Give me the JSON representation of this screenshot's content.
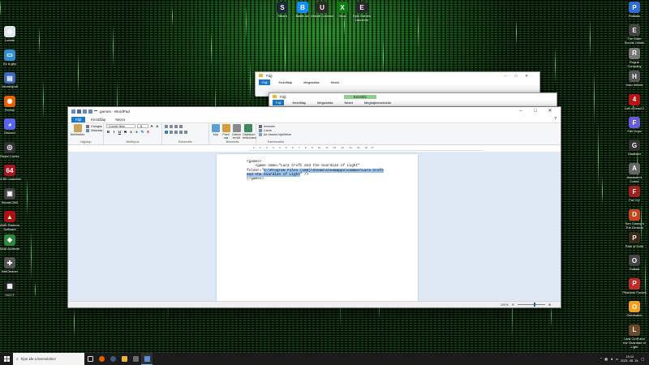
{
  "desktop": {
    "top_icons": [
      {
        "label": "Steam",
        "color": "#1b2838",
        "glyph": "S"
      },
      {
        "label": "Battle.net",
        "color": "#148eff",
        "glyph": "B"
      },
      {
        "label": "Ubisoft Connect",
        "color": "#2b2b2b",
        "glyph": "U"
      },
      {
        "label": "Xbox",
        "color": "#107c10",
        "glyph": "X"
      },
      {
        "label": "Epic Games Launcher",
        "color": "#2a2a2a",
        "glyph": "E"
      }
    ],
    "left_icons": [
      {
        "label": "Lomtár",
        "color": "#dfe6ee",
        "glyph": "♻"
      },
      {
        "label": "Ez a gép",
        "color": "#2f8ed8",
        "glyph": "▭"
      },
      {
        "label": "Vezérlőpult",
        "color": "#3a66c4",
        "glyph": "▤"
      },
      {
        "label": "Firefox",
        "color": "#e66000",
        "glyph": "◉"
      },
      {
        "label": "Discord",
        "color": "#5865f2",
        "glyph": "◕"
      },
      {
        "label": "Razer Cortex",
        "color": "#333",
        "glyph": "◎"
      },
      {
        "label": "64 Bit Launcher",
        "color": "#b01020",
        "glyph": "64"
      },
      {
        "label": "SteamCMD",
        "color": "#444",
        "glyph": "▣"
      },
      {
        "label": "AMD Radeon Software",
        "color": "#b01010",
        "glyph": "▲"
      },
      {
        "label": "SAM Achiever",
        "color": "#2a8a3a",
        "glyph": "◆"
      },
      {
        "label": "NetCleaner",
        "color": "#555",
        "glyph": "✚"
      },
      {
        "label": "OCCT",
        "color": "#222",
        "glyph": "▦"
      }
    ],
    "right_icons": [
      {
        "label": "Palladin",
        "color": "#2a6ed6",
        "glyph": "P"
      },
      {
        "label": "The Elder Scrolls Online",
        "color": "#444",
        "glyph": "E"
      },
      {
        "label": "Rogue Company",
        "color": "#777",
        "glyph": "R"
      },
      {
        "label": "Halo Infinite",
        "color": "#555",
        "glyph": "H"
      },
      {
        "label": "Left 4 Dead 2",
        "color": "#b11",
        "glyph": "4"
      },
      {
        "label": "Fall Guys",
        "color": "#6a5ad6",
        "glyph": "F"
      },
      {
        "label": "Gladiator",
        "color": "#333",
        "glyph": "G"
      },
      {
        "label": "Assassin's Creed",
        "color": "#666",
        "glyph": "A"
      },
      {
        "label": "Far Cry",
        "color": "#a0201a",
        "glyph": "F"
      },
      {
        "label": "Tom Clancy's The Division",
        "color": "#c6461a",
        "glyph": "D"
      },
      {
        "label": "Path of Exile",
        "color": "#3a2a1a",
        "glyph": "P"
      },
      {
        "label": "Outlast",
        "color": "#444",
        "glyph": "O"
      },
      {
        "label": "Phantom Forces",
        "color": "#c42a2a",
        "glyph": "P"
      },
      {
        "label": "Overwatch",
        "color": "#f99e1a",
        "glyph": "O"
      },
      {
        "label": "Lara Croft and the Guardian of Light",
        "color": "#6a4a2a",
        "glyph": "L"
      }
    ]
  },
  "explorer1": {
    "title": "Fájl",
    "tabs": [
      "Fájl",
      "Kezdőlap",
      "Megosztás",
      "Nézet"
    ]
  },
  "explorer2": {
    "title": "Fájl",
    "tabs": [
      "Fájl",
      "Kezdőlap",
      "Megosztás",
      "Nézet",
      "Meghajtóeszközök"
    ],
    "manage": "Kezelés"
  },
  "wordpad": {
    "title": "games - WordPad",
    "tabs": [
      "Fájl",
      "Kezdőlap",
      "Nézet"
    ],
    "clipboard": {
      "paste": "Beillesztés",
      "cut": "Kivágás",
      "copy": "Másolás",
      "group": "Vágólap"
    },
    "font": {
      "name": "Courier New",
      "size": "11",
      "group": "Betűtípus"
    },
    "paragraph": {
      "group": "Bekezdés"
    },
    "insert": {
      "image": "Kép",
      "paint": "Paint rajz",
      "datetime": "Dátum és idő",
      "object": "Objektum beszúrása",
      "group": "Beszúrás"
    },
    "edit": {
      "find": "Keresés",
      "replace": "Csere",
      "select_all": "Az összes kijelölése",
      "group": "Szerkesztés"
    },
    "document": {
      "line1": "<games>",
      "line2": "    <game name=\"Lara Croft and the Guardian of Light\"",
      "line3_pre": "folder=\"",
      "line3_hl": "C:\\Program Files (x86)\\Steam\\steamapps\\common\\Lara Croft",
      "line4_hl": "and the Guardian of Light",
      "line4_post": "\" />",
      "line5": "</games>"
    },
    "status": {
      "zoom": "100%"
    }
  },
  "taskbar": {
    "search_placeholder": "Írjon ide a kereséshez",
    "time": "19:12",
    "date": "2021. 05. 15."
  }
}
